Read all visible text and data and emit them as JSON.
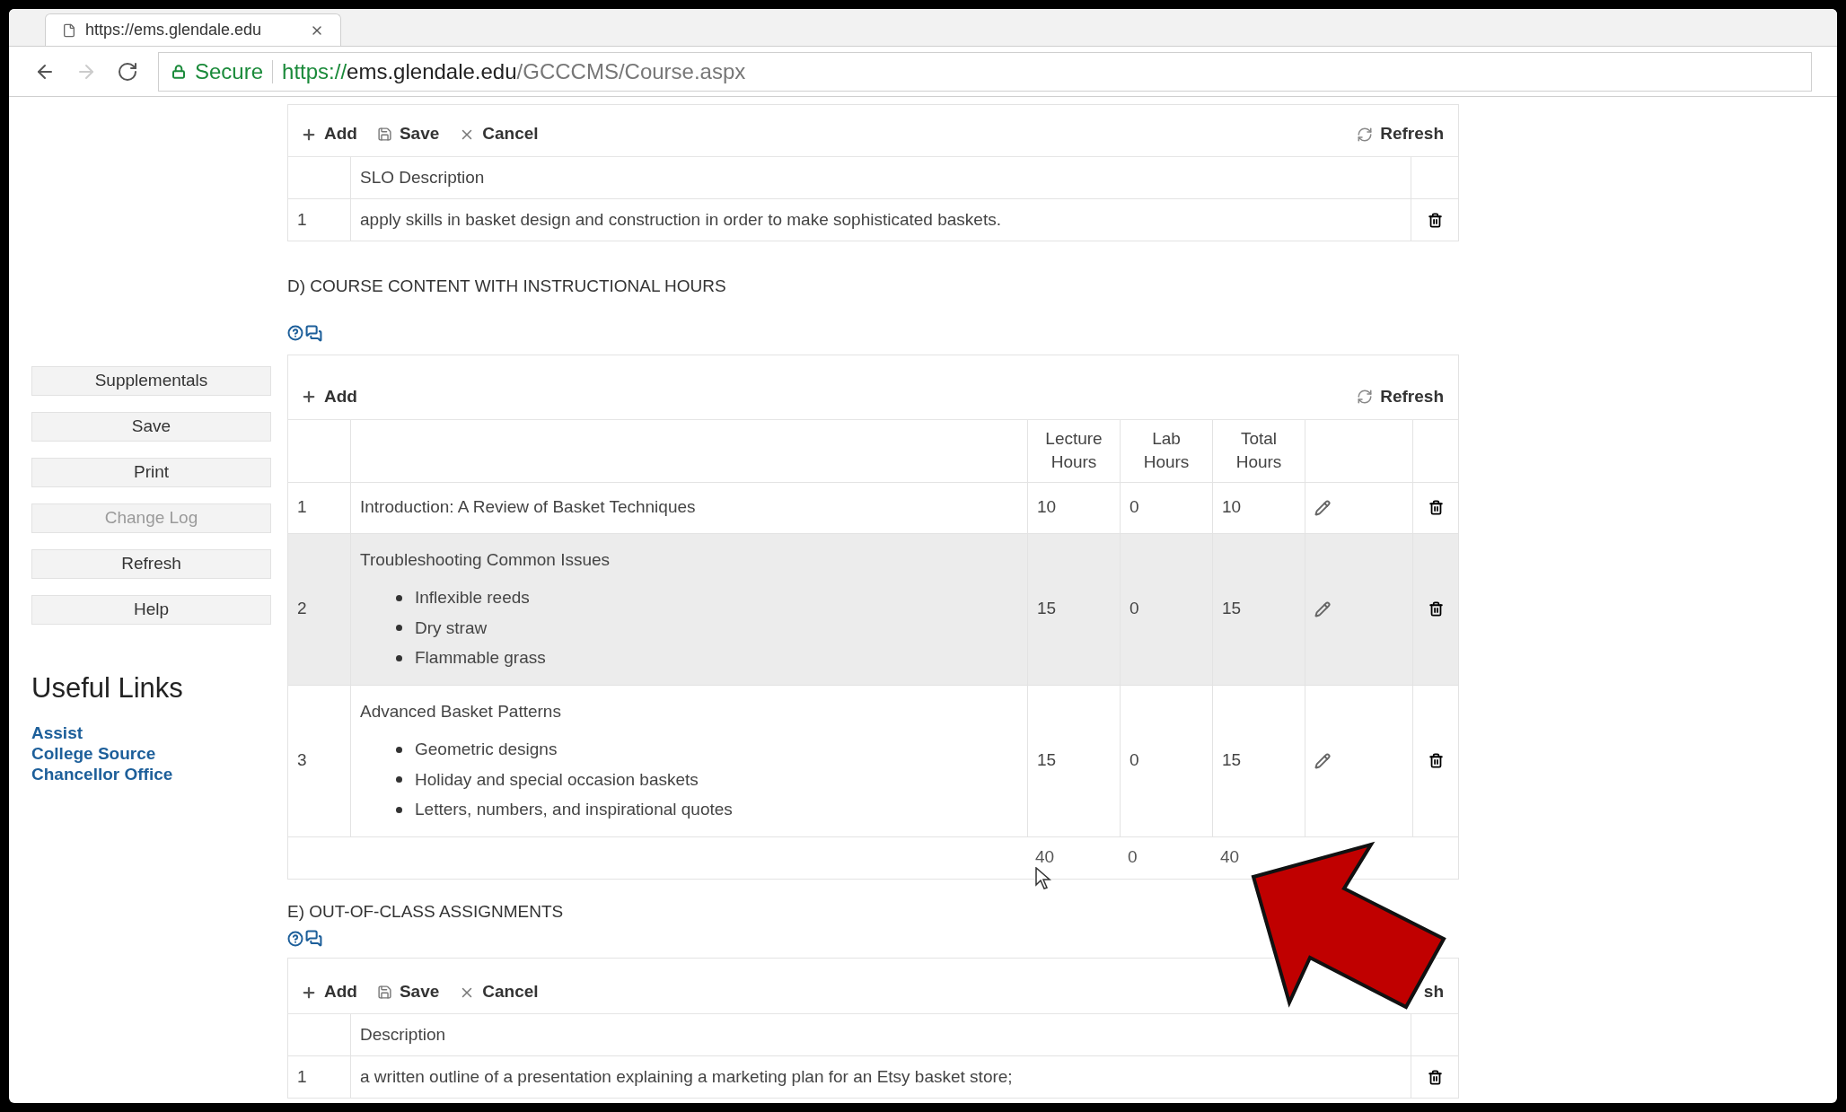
{
  "browser": {
    "tab": {
      "title": "https://ems.glendale.edu"
    },
    "address": {
      "security": "Secure",
      "url_scheme": "https://",
      "url_host": "ems.glendale.edu",
      "url_path": "/GCCCMS/Course.aspx"
    }
  },
  "sidebar": {
    "buttons": [
      {
        "label": "Supplementals",
        "disabled": false
      },
      {
        "label": "Save",
        "disabled": false
      },
      {
        "label": "Print",
        "disabled": false
      },
      {
        "label": "Change Log",
        "disabled": true
      },
      {
        "label": "Refresh",
        "disabled": false
      },
      {
        "label": "Help",
        "disabled": false
      }
    ],
    "links_title": "Useful Links",
    "links": [
      "Assist",
      "College Source",
      "Chancellor Office"
    ]
  },
  "slo_section": {
    "toolbar": [
      {
        "kind": "add",
        "label": "Add"
      },
      {
        "kind": "save",
        "label": "Save"
      },
      {
        "kind": "cancel",
        "label": "Cancel"
      }
    ],
    "refresh": "Refresh",
    "columns": [
      "SLO Description"
    ],
    "rows": [
      {
        "number": "1",
        "description": "apply skills in basket design and construction in order to make sophisticated baskets."
      }
    ]
  },
  "content_section": {
    "title": "D) COURSE CONTENT WITH INSTRUCTIONAL HOURS",
    "toolbar": [
      {
        "kind": "add",
        "label": "Add"
      }
    ],
    "refresh": "Refresh",
    "columns": [
      "Lecture Hours",
      "Lab Hours",
      "Total Hours"
    ],
    "rows": [
      {
        "number": "1",
        "title": "Introduction:  A Review of Basket Techniques",
        "bullets": [],
        "lecture": "10",
        "lab": "0",
        "total": "10",
        "selected": false
      },
      {
        "number": "2",
        "title": "Troubleshooting Common Issues",
        "bullets": [
          "Inflexible reeds",
          "Dry straw",
          "Flammable grass"
        ],
        "lecture": "15",
        "lab": "0",
        "total": "15",
        "selected": true
      },
      {
        "number": "3",
        "title": "Advanced Basket Patterns",
        "bullets": [
          "Geometric designs",
          "Holiday and special occasion baskets",
          "Letters, numbers, and inspirational quotes"
        ],
        "lecture": "15",
        "lab": "0",
        "total": "15",
        "selected": false
      }
    ],
    "totals": [
      "40",
      "0",
      "40"
    ]
  },
  "assignments_section": {
    "title": "E) OUT-OF-CLASS ASSIGNMENTS",
    "toolbar": [
      {
        "kind": "add",
        "label": "Add"
      },
      {
        "kind": "save",
        "label": "Save"
      },
      {
        "kind": "cancel",
        "label": "Cancel"
      }
    ],
    "refresh": "sh",
    "columns": [
      "Description"
    ],
    "rows": [
      {
        "number": "1",
        "description": "a written outline of a presentation explaining a marketing plan for an Etsy basket store;"
      }
    ]
  }
}
